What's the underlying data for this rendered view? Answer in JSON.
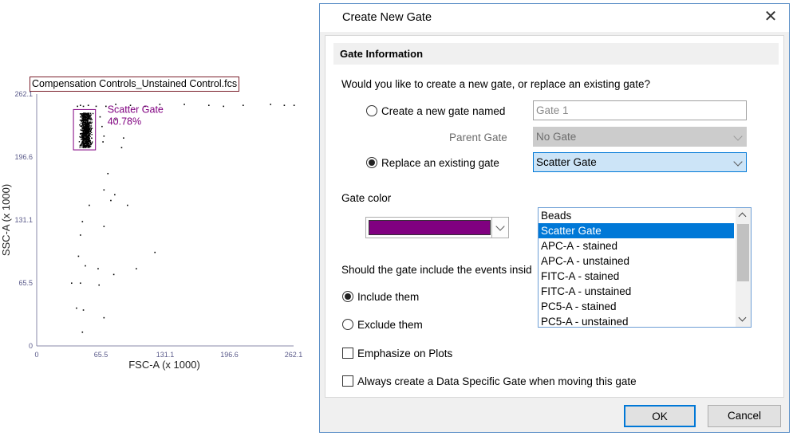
{
  "plot": {
    "title": "Compensation Controls_Unstained Control.fcs",
    "x_label": "FSC-A (x 1000)",
    "y_label": "SSC-A (x 1000)",
    "x_ticks": [
      "0",
      "65.5",
      "131.1",
      "196.6",
      "262.1"
    ],
    "y_ticks": [
      "0",
      "65.5",
      "131.1",
      "196.6",
      "262.1"
    ],
    "gate_name": "Scatter Gate",
    "gate_percent": "40.78%",
    "gate_color": "#800080",
    "point_color": "#000000"
  },
  "chart_data": {
    "type": "scatter",
    "title": "Compensation Controls_Unstained Control.fcs",
    "xlabel": "FSC-A (x 1000)",
    "ylabel": "SSC-A (x 1000)",
    "xlim": [
      0,
      262.1
    ],
    "ylim": [
      0,
      262.1
    ],
    "x_ticks": [
      0,
      65.5,
      131.1,
      196.6,
      262.1
    ],
    "y_ticks": [
      0,
      65.5,
      131.1,
      196.6,
      262.1
    ],
    "gate": {
      "name": "Scatter Gate",
      "percent": "40.78%",
      "x": [
        37.5,
        60
      ],
      "y": [
        204,
        246
      ]
    },
    "cluster": {
      "x_center": 50,
      "x_spread": 4,
      "y_min": 207,
      "y_max": 243
    },
    "scattered_points": [
      [
        41,
        250
      ],
      [
        44,
        251
      ],
      [
        47,
        250
      ],
      [
        52,
        251
      ],
      [
        60,
        250
      ],
      [
        70,
        250
      ],
      [
        80,
        252
      ],
      [
        95,
        251
      ],
      [
        110,
        250
      ],
      [
        125,
        252
      ],
      [
        150,
        252
      ],
      [
        175,
        251
      ],
      [
        190,
        250
      ],
      [
        210,
        251
      ],
      [
        238,
        252
      ],
      [
        252,
        251
      ],
      [
        262,
        251
      ],
      [
        64,
        239
      ],
      [
        66,
        229
      ],
      [
        68,
        219
      ],
      [
        67,
        213
      ],
      [
        80,
        236
      ],
      [
        86,
        207
      ],
      [
        88,
        217
      ],
      [
        72,
        180
      ],
      [
        68,
        163
      ],
      [
        79,
        158
      ],
      [
        53,
        147
      ],
      [
        75,
        152
      ],
      [
        92,
        147
      ],
      [
        68,
        125
      ],
      [
        46,
        130
      ],
      [
        44,
        116
      ],
      [
        120,
        98
      ],
      [
        42,
        94
      ],
      [
        62,
        81
      ],
      [
        49,
        84
      ],
      [
        78,
        75
      ],
      [
        101,
        81
      ],
      [
        44,
        66
      ],
      [
        63,
        64
      ],
      [
        35,
        66
      ],
      [
        40,
        40
      ],
      [
        47,
        38
      ],
      [
        68,
        30
      ],
      [
        46,
        15
      ]
    ]
  },
  "dialog": {
    "title": "Create New Gate",
    "section_header": "Gate Information",
    "question": "Would you like to create a new gate, or replace an existing gate?",
    "create_new_label": "Create a new gate named",
    "gate_name_value": "Gate 1",
    "parent_gate_label": "Parent Gate",
    "parent_gate_value": "No Gate",
    "replace_label": "Replace an existing gate",
    "replace_value": "Scatter Gate",
    "dropdown_items": [
      "Beads",
      "Scatter Gate",
      "APC-A - stained",
      "APC-A - unstained",
      "FITC-A - stained",
      "FITC-A - unstained",
      "PC5-A - stained",
      "PC5-A - unstained"
    ],
    "dropdown_selected": 1,
    "gate_color_label": "Gate color",
    "gate_color_value": "#800080",
    "include_question": "Should the gate include the events insid",
    "include_label": "Include them",
    "exclude_label": "Exclude them",
    "emphasize_label": "Emphasize on Plots",
    "data_specific_label": "Always create a Data Specific Gate when moving this gate",
    "ok_label": "OK",
    "cancel_label": "Cancel"
  }
}
